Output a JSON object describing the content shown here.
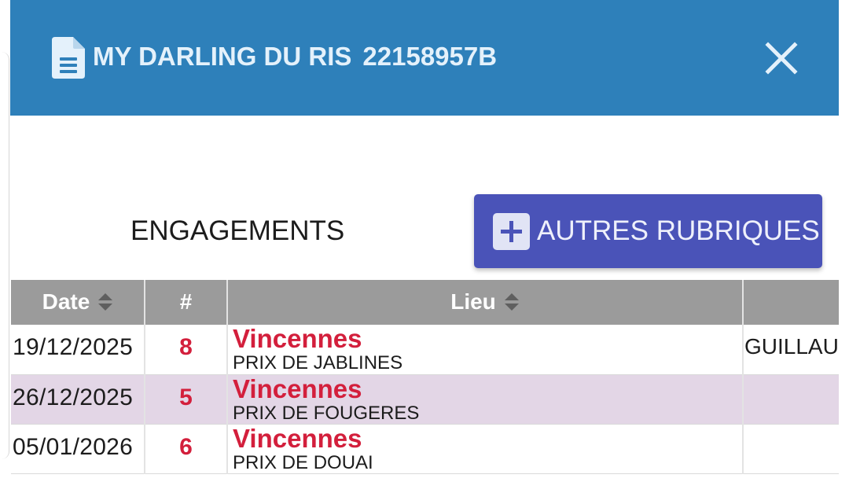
{
  "header": {
    "title": "MY DARLING DU RIS",
    "code": "22158957B",
    "icon": "document-icon",
    "close_icon": "close-icon",
    "bg_color": "#2e80ba"
  },
  "tabs": {
    "engagements_label": "ENGAGEMENTS"
  },
  "autres_button": {
    "label": "AUTRES RUBRIQUES",
    "icon": "plus-square-icon",
    "bg_color": "#4a53b8"
  },
  "table": {
    "columns": [
      "Date",
      "#",
      "Lieu"
    ],
    "sortable": [
      "Date",
      "Lieu"
    ],
    "header_color": "#9b9b9b",
    "accent_color": "#d31f3c",
    "alt_row_color": "#e3d6e6",
    "rows": [
      {
        "date": "19/12/2025",
        "num": "8",
        "lieu": "Vincennes",
        "prix": "PRIX DE JABLINES",
        "extra": "GUILLAU"
      },
      {
        "date": "26/12/2025",
        "num": "5",
        "lieu": "Vincennes",
        "prix": "PRIX DE FOUGERES",
        "extra": ""
      },
      {
        "date": "05/01/2026",
        "num": "6",
        "lieu": "Vincennes",
        "prix": "PRIX DE DOUAI",
        "extra": ""
      }
    ]
  }
}
